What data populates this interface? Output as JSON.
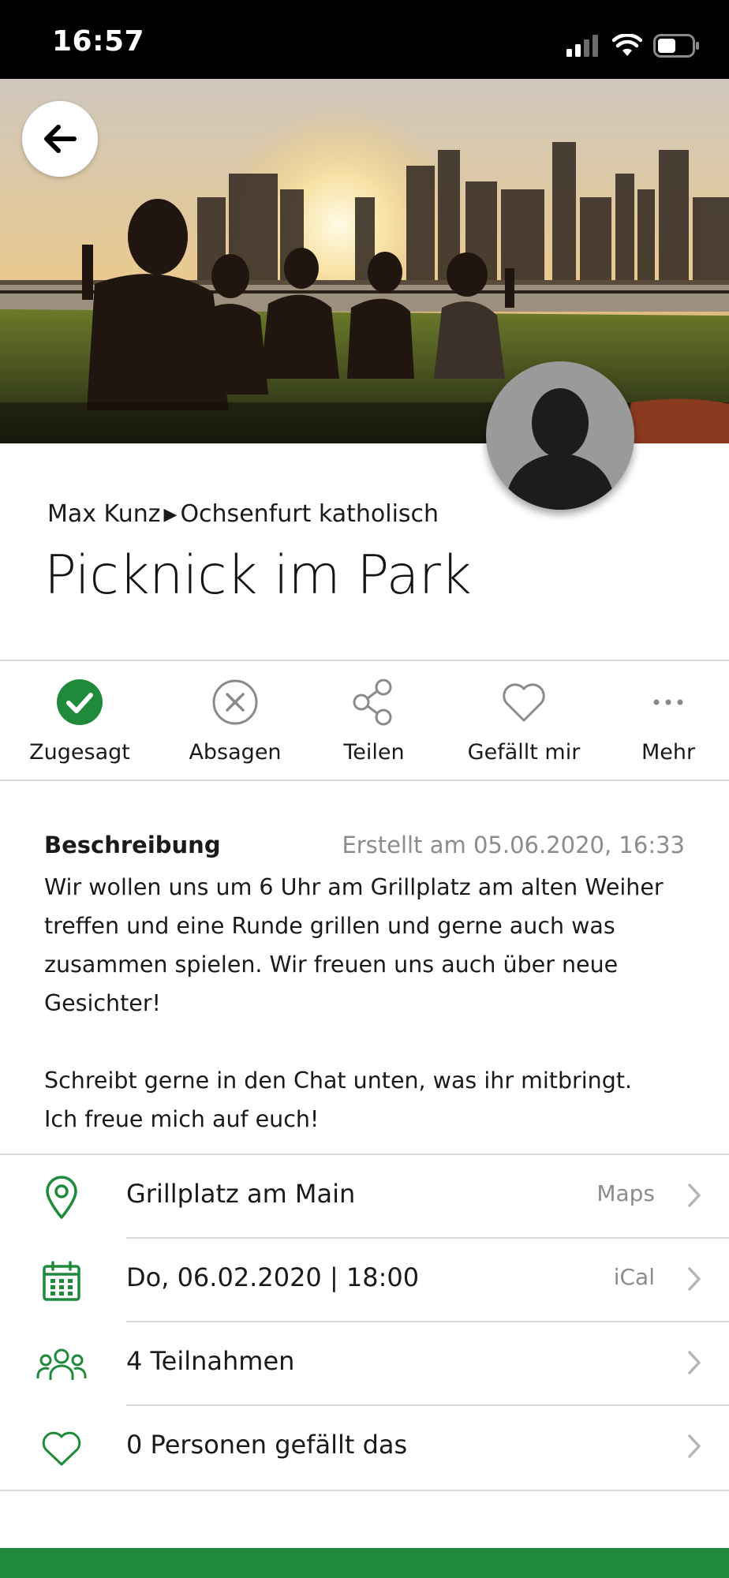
{
  "status_bar": {
    "time": "16:57"
  },
  "event": {
    "organizer": "Max Kunz",
    "group": "Ochsenfurt katholisch",
    "title": "Picknick im Park"
  },
  "actions": [
    {
      "label": "Zugesagt",
      "icon": "check-circle-icon",
      "active": true
    },
    {
      "label": "Absagen",
      "icon": "x-circle-icon"
    },
    {
      "label": "Teilen",
      "icon": "share-icon"
    },
    {
      "label": "Gefällt mir",
      "icon": "heart-icon"
    },
    {
      "label": "Mehr",
      "icon": "more-icon"
    }
  ],
  "description": {
    "heading": "Beschreibung",
    "created": "Erstellt am 05.06.2020, 16:33",
    "lines": [
      "Wir wollen uns um 6 Uhr am Grillplatz am alten Weiher",
      "treffen und eine Runde grillen und gerne auch was",
      "zusammen spielen. Wir freuen uns auch über neue Gesichter!",
      "Schreibt gerne in den Chat unten, was ihr mitbringt.",
      "Ich freue mich auf euch!"
    ]
  },
  "info_rows": [
    {
      "icon": "location-pin-icon",
      "text": "Grillplatz am Main",
      "action": "Maps"
    },
    {
      "icon": "calendar-icon",
      "text": "Do, 06.02.2020 | 18:00",
      "action": "iCal"
    },
    {
      "icon": "people-icon",
      "text": "4 Teilnahmen",
      "action": ""
    },
    {
      "icon": "heart-icon",
      "text": "0 Personen gefällt das",
      "action": ""
    }
  ],
  "colors": {
    "accent": "#1f8a3a",
    "muted": "#8c8c8c"
  }
}
